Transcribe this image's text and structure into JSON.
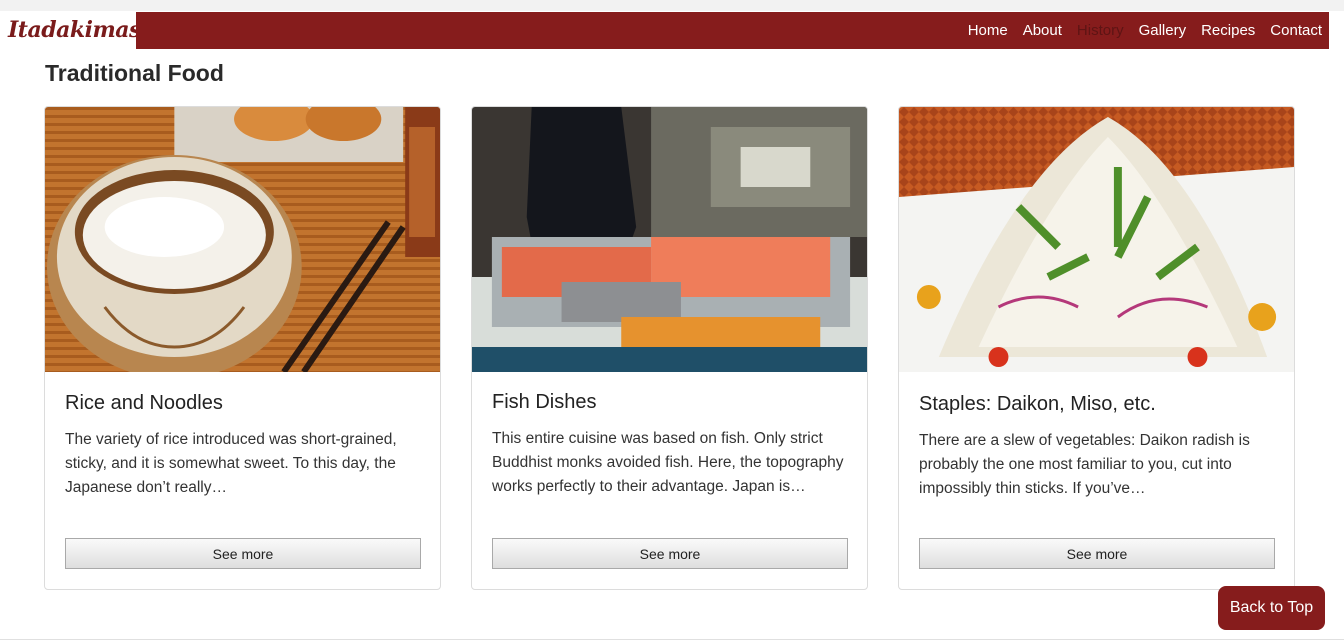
{
  "brand": {
    "logo_text": "Itadakimasu"
  },
  "nav": {
    "items": [
      {
        "label": "Home"
      },
      {
        "label": "About"
      },
      {
        "label": "History"
      },
      {
        "label": "Gallery"
      },
      {
        "label": "Recipes"
      },
      {
        "label": "Contact"
      }
    ],
    "active": "History"
  },
  "section": {
    "title": "Traditional Food"
  },
  "cards": [
    {
      "title": "Rice and Noodles",
      "text": "The variety of rice introduced was short-grained, sticky, and it is somewhat sweet. To this day, the Japanese don’t really…",
      "button": "See more"
    },
    {
      "title": "Fish Dishes",
      "text": "This entire cuisine was based on fish. Only strict Buddhist monks avoided fish. Here, the topography works perfectly to their advantage. Japan is…",
      "button": "See more"
    },
    {
      "title": "Staples: Daikon, Miso, etc.",
      "text": "There are a slew of vegetables: Daikon radish is probably the one most familiar to you, cut into impossibly thin sticks. If you’ve…",
      "button": "See more"
    }
  ],
  "back_to_top": "Back to Top",
  "colors": {
    "brand": "#861c1c",
    "active_nav": "#5e1414"
  }
}
